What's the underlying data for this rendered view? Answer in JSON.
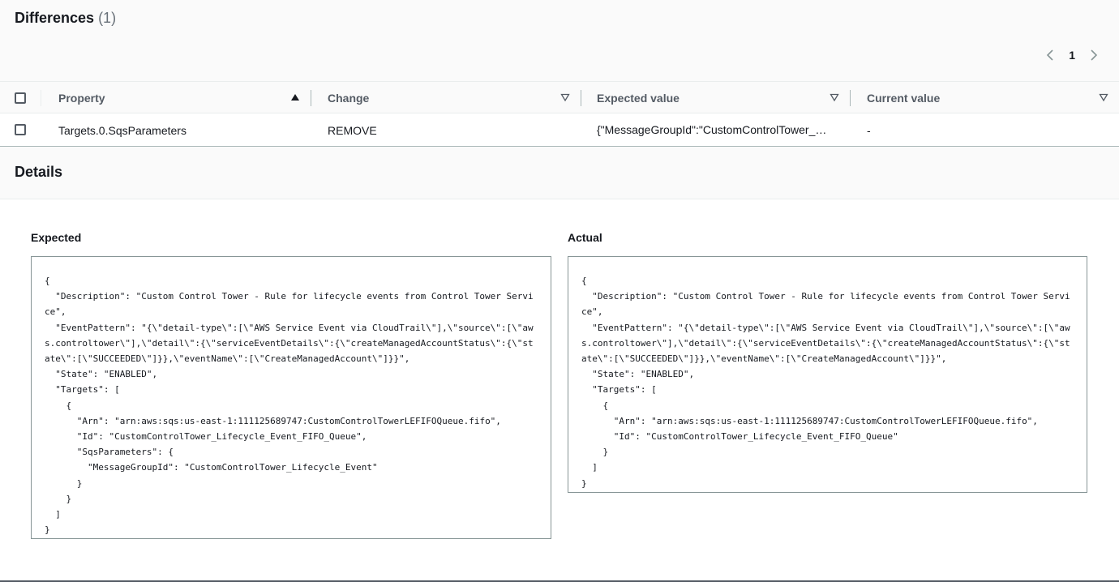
{
  "differences": {
    "title": "Differences",
    "count": "(1)",
    "pagination": {
      "current_page": "1"
    }
  },
  "table": {
    "columns": [
      {
        "label": "Property",
        "sort": "ascending"
      },
      {
        "label": "Change",
        "sort": "none"
      },
      {
        "label": "Expected value",
        "sort": "none"
      },
      {
        "label": "Current value",
        "sort": "none"
      }
    ],
    "rows": [
      {
        "property": "Targets.0.SqsParameters",
        "change": "REMOVE",
        "expected_value": "{\"MessageGroupId\":\"CustomControlTower_Lifecycle_Event\"}",
        "current_value": "-"
      }
    ]
  },
  "details": {
    "title": "Details",
    "expected": {
      "label": "Expected",
      "code": "{\n  \"Description\": \"Custom Control Tower - Rule for lifecycle events from Control Tower Service\",\n  \"EventPattern\": \"{\\\"detail-type\\\":[\\\"AWS Service Event via CloudTrail\\\"],\\\"source\\\":[\\\"aws.controltower\\\"],\\\"detail\\\":{\\\"serviceEventDetails\\\":{\\\"createManagedAccountStatus\\\":{\\\"state\\\":[\\\"SUCCEEDED\\\"]}},\\\"eventName\\\":[\\\"CreateManagedAccount\\\"]}}\",\n  \"State\": \"ENABLED\",\n  \"Targets\": [\n    {\n      \"Arn\": \"arn:aws:sqs:us-east-1:111125689747:CustomControlTowerLEFIFOQueue.fifo\",\n      \"Id\": \"CustomControlTower_Lifecycle_Event_FIFO_Queue\",\n      \"SqsParameters\": {\n        \"MessageGroupId\": \"CustomControlTower_Lifecycle_Event\"\n      }\n    }\n  ]\n}"
    },
    "actual": {
      "label": "Actual",
      "code": "{\n  \"Description\": \"Custom Control Tower - Rule for lifecycle events from Control Tower Service\",\n  \"EventPattern\": \"{\\\"detail-type\\\":[\\\"AWS Service Event via CloudTrail\\\"],\\\"source\\\":[\\\"aws.controltower\\\"],\\\"detail\\\":{\\\"serviceEventDetails\\\":{\\\"createManagedAccountStatus\\\":{\\\"state\\\":[\\\"SUCCEEDED\\\"]}},\\\"eventName\\\":[\\\"CreateManagedAccount\\\"]}}\",\n  \"State\": \"ENABLED\",\n  \"Targets\": [\n    {\n      \"Arn\": \"arn:aws:sqs:us-east-1:111125689747:CustomControlTowerLEFIFOQueue.fifo\",\n      \"Id\": \"CustomControlTower_Lifecycle_Event_FIFO_Queue\"\n    }\n  ]\n}"
    }
  },
  "icons": {
    "prev": "chevron-left-icon",
    "next": "chevron-right-icon",
    "sort_asc": "caret-up-filled-icon",
    "sort_none": "caret-down-outline-icon"
  },
  "colors": {
    "text": "#16191f",
    "muted": "#687078",
    "header_bg": "#fafafa",
    "border": "#aab7b8"
  }
}
